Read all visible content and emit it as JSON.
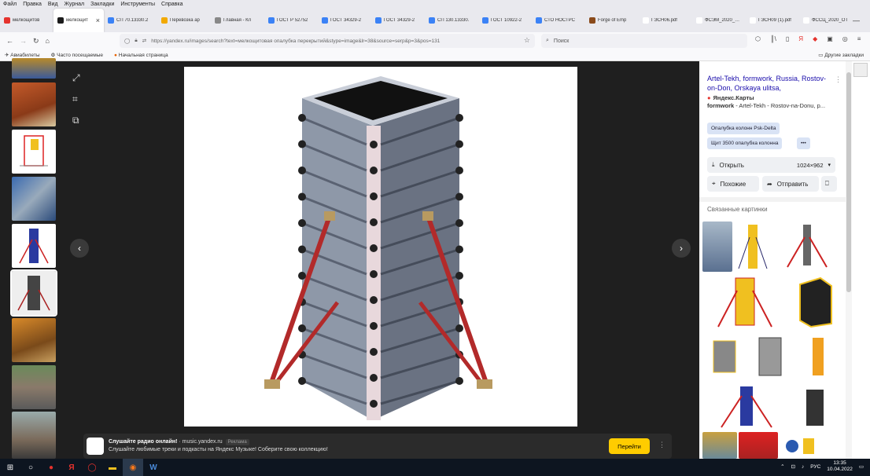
{
  "menu": [
    "Файл",
    "Правка",
    "Вид",
    "Журнал",
    "Закладки",
    "Инструменты",
    "Справка"
  ],
  "tabs": [
    {
      "label": "мелкощитов",
      "color": "#e5322d",
      "active": false
    },
    {
      "label": "мелкощит",
      "color": "#1b1b1b",
      "active": true
    },
    {
      "label": "СП 70.13330.2",
      "color": "#3b82f6",
      "active": false
    },
    {
      "label": "Перевозка ар",
      "color": "#f2a900",
      "active": false
    },
    {
      "label": "Главная - Кл",
      "color": "#888888",
      "active": false
    },
    {
      "label": "ГОСТ Р 52752",
      "color": "#3b82f6",
      "active": false
    },
    {
      "label": "ГОСТ 34329-2",
      "color": "#3b82f6",
      "active": false
    },
    {
      "label": "ГОСТ 34329-2",
      "color": "#3b82f6",
      "active": false
    },
    {
      "label": "СП 130.13330.",
      "color": "#3b82f6",
      "active": false
    },
    {
      "label": "ГОСТ 10922-2",
      "color": "#3b82f6",
      "active": false
    },
    {
      "label": "СТО НОСТРС",
      "color": "#3b82f6",
      "active": false
    },
    {
      "label": "Forge of Emp",
      "color": "#8a4a1a",
      "active": false
    },
    {
      "label": "ГЭСН06.pdf",
      "color": "#ffffff",
      "active": false
    },
    {
      "label": "ФСЭМ_2020_СП_",
      "color": "#ffffff",
      "active": false
    },
    {
      "label": "ГЭСН09 (1).pdf",
      "color": "#ffffff",
      "active": false
    },
    {
      "label": "ФССЦ_2020_ОТ",
      "color": "#ffffff",
      "active": false
    }
  ],
  "nav": {
    "url": "https://yandex.ru/images/search?text=мелкощитовая опалубка перекрытий&stype=image&lr=38&source=serp&p=3&pos=131",
    "search_placeholder": "Поиск"
  },
  "bookmarks": {
    "items": [
      "Авиабилеты",
      "Часто посещаемые",
      "Начальная страница"
    ],
    "other": "Другие закладки"
  },
  "ad": {
    "title": "Слушайте радио онлайн!",
    "domain": "· music.yandex.ru",
    "badge": "Реклама",
    "text": "Слушайте любимые треки и подкасты на Яндекс Музыке! Соберите свою коллекцию!",
    "button": "Перейти"
  },
  "panel": {
    "title": "Artel-Tekh, formwork, Russia, Rostov-on-Don, Orskaya ulitsa,",
    "source": "Яндекс.Карты",
    "desc_bold": "formwork",
    "desc": " - Artel-Tekh - Rostov-na-Donu, p...",
    "chips": [
      "Опалубка колонн Psk-Delta",
      "Щит 3500 опалубка колонна",
      "•••"
    ],
    "open": "Открыть",
    "size": "1024×962",
    "similar": "Похожие",
    "send": "Отправить",
    "related_title": "Связанные картинки"
  },
  "taskbar": {
    "lang": "РУС",
    "time": "13:35",
    "date": "10.04.2022"
  }
}
